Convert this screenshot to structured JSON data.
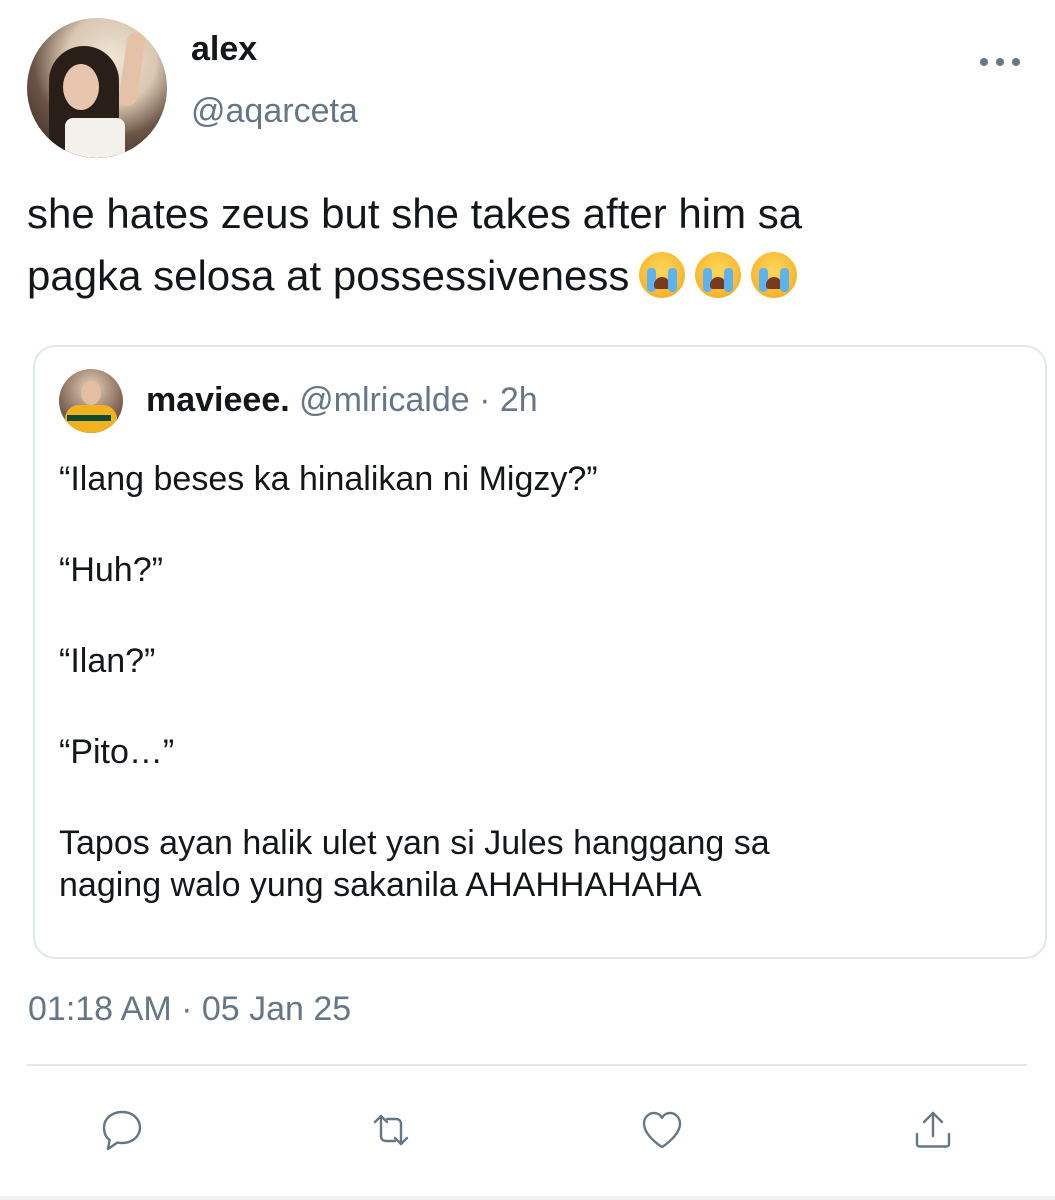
{
  "tweet": {
    "author": {
      "display_name": "alex",
      "handle": "@aqarceta"
    },
    "text_line1": "she hates zeus but she takes after him sa",
    "text_line2": "pagka selosa at possessiveness",
    "emoji": "loudly-crying-face",
    "timestamp": "01:18 AM · 05 Jan 25"
  },
  "quote": {
    "display_name": "mavieee.",
    "meta": "@mlricalde · 2h",
    "lines": [
      "“Ilang beses ka hinalikan ni Migzy?”",
      "“Huh?”",
      "“Ilan?”",
      "“Pito…”"
    ],
    "final_line1": "Tapos ayan halik ulet yan si Jules hanggang sa",
    "final_line2": "naging walo yung sakanila AHAHHAHAHA"
  },
  "actions": {
    "reply": "reply-icon",
    "retweet": "retweet-icon",
    "like": "heart-icon",
    "share": "share-icon"
  },
  "colors": {
    "text": "#14171a",
    "secondary": "#657786",
    "border": "#e1e8ed"
  }
}
